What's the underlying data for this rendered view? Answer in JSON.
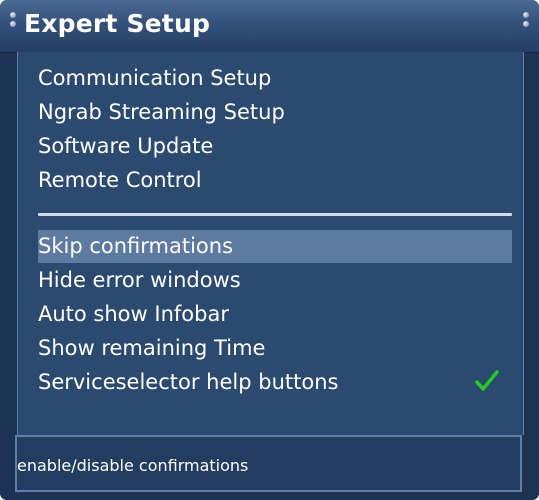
{
  "window": {
    "title": "Expert Setup"
  },
  "menu": {
    "items": [
      {
        "label": "Communication Setup"
      },
      {
        "label": "Ngrab Streaming Setup"
      },
      {
        "label": "Software Update"
      },
      {
        "label": "Remote Control"
      }
    ],
    "toggles": [
      {
        "label": "Skip confirmations",
        "selected": true,
        "checked": false
      },
      {
        "label": "Hide error windows",
        "selected": false,
        "checked": false
      },
      {
        "label": "Auto show Infobar",
        "selected": false,
        "checked": false
      },
      {
        "label": "Show remaining Time",
        "selected": false,
        "checked": false
      },
      {
        "label": "Serviceselector help buttons",
        "selected": false,
        "checked": true
      }
    ]
  },
  "help": {
    "text": "enable/disable confirmations"
  },
  "colors": {
    "check": "#22cc22",
    "selection": "#5d7ba0",
    "background": "#2b4a6f"
  },
  "icons": {
    "check": "checkmark-icon"
  }
}
